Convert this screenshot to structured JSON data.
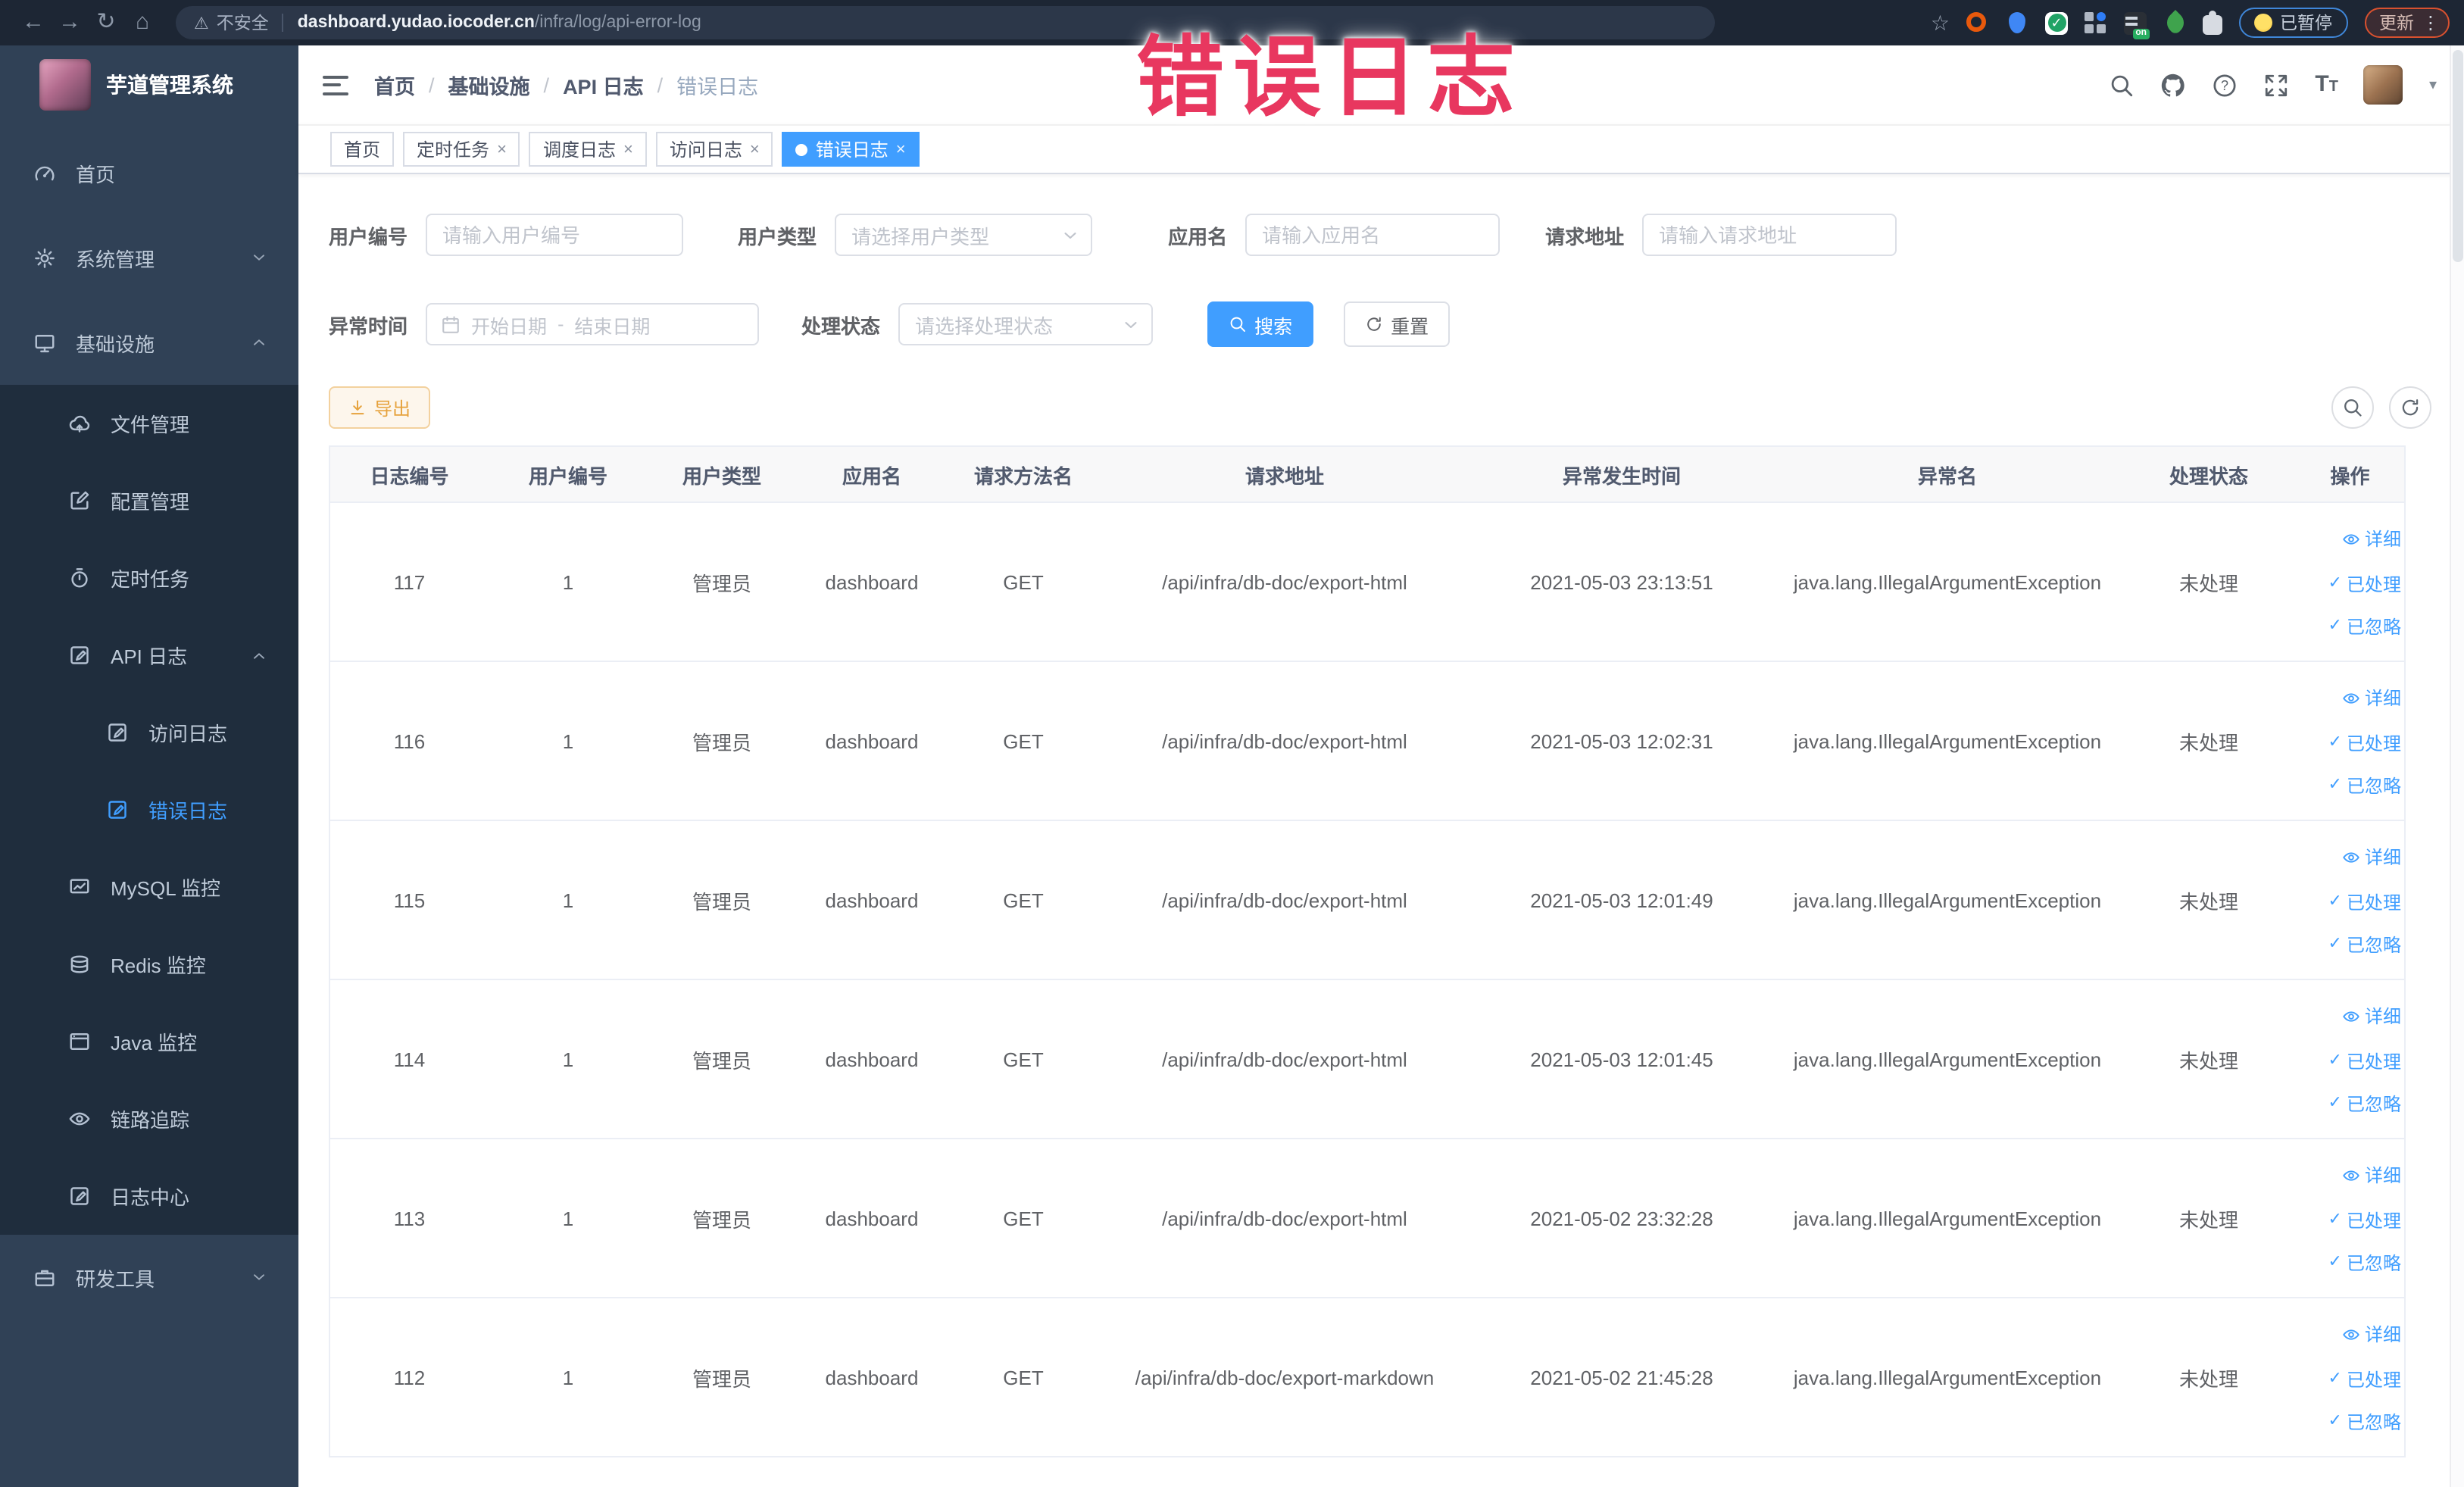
{
  "browser": {
    "security_warning": "不安全",
    "url_domain": "dashboard.yudao.iocoder.cn",
    "url_path": "/infra/log/api-error-log",
    "paused_badge": "已暂停",
    "update_button": "更新"
  },
  "overlay_title": "错误日志",
  "sidebar": {
    "logo_title": "芋道管理系统",
    "menu": [
      {
        "key": "home",
        "label": "首页",
        "icon": "gauge",
        "level": 1
      },
      {
        "key": "system-mgmt",
        "label": "系统管理",
        "icon": "gear",
        "level": 1,
        "chevron": "down"
      },
      {
        "key": "infrastructure",
        "label": "基础设施",
        "icon": "monitor",
        "level": 1,
        "chevron": "up"
      },
      {
        "key": "file-mgmt",
        "label": "文件管理",
        "icon": "cloud",
        "level": 2,
        "group": true
      },
      {
        "key": "config-mgmt",
        "label": "配置管理",
        "icon": "editpen",
        "level": 2,
        "group": true
      },
      {
        "key": "scheduled-tasks",
        "label": "定时任务",
        "icon": "timer",
        "level": 2,
        "group": true
      },
      {
        "key": "api-log",
        "label": "API 日志",
        "icon": "logdoc",
        "level": 2,
        "group": true,
        "chevron": "up"
      },
      {
        "key": "access-log",
        "label": "访问日志",
        "icon": "logdoc",
        "level": 3,
        "group": true
      },
      {
        "key": "error-log",
        "label": "错误日志",
        "icon": "logdoc",
        "level": 3,
        "group": true,
        "active": true
      },
      {
        "key": "mysql-monitor",
        "label": "MySQL 监控",
        "icon": "mysql",
        "level": 2,
        "group": true
      },
      {
        "key": "redis-monitor",
        "label": "Redis 监控",
        "icon": "redis",
        "level": 2,
        "group": true
      },
      {
        "key": "java-monitor",
        "label": "Java 监控",
        "icon": "java",
        "level": 2,
        "group": true
      },
      {
        "key": "trace",
        "label": "链路追踪",
        "icon": "eye",
        "level": 2,
        "group": true
      },
      {
        "key": "log-center",
        "label": "日志中心",
        "icon": "logdoc",
        "level": 2,
        "group": true
      },
      {
        "key": "dev-tools",
        "label": "研发工具",
        "icon": "briefcase",
        "level": 1,
        "chevron": "down"
      }
    ]
  },
  "header": {
    "breadcrumb": [
      "首页",
      "基础设施",
      "API 日志",
      "错误日志"
    ]
  },
  "tabs": [
    {
      "label": "首页",
      "closable": false,
      "active": false
    },
    {
      "label": "定时任务",
      "closable": true,
      "active": false
    },
    {
      "label": "调度日志",
      "closable": true,
      "active": false
    },
    {
      "label": "访问日志",
      "closable": true,
      "active": false
    },
    {
      "label": "错误日志",
      "closable": true,
      "active": true
    }
  ],
  "filters": {
    "user_id": {
      "label": "用户编号",
      "placeholder": "请输入用户编号"
    },
    "user_type": {
      "label": "用户类型",
      "placeholder": "请选择用户类型"
    },
    "app_name": {
      "label": "应用名",
      "placeholder": "请输入应用名"
    },
    "request_url": {
      "label": "请求地址",
      "placeholder": "请输入请求地址"
    },
    "exception_time": {
      "label": "异常时间",
      "start_placeholder": "开始日期",
      "separator": "-",
      "end_placeholder": "结束日期"
    },
    "process_status": {
      "label": "处理状态",
      "placeholder": "请选择处理状态"
    },
    "search_button": "搜索",
    "reset_button": "重置"
  },
  "toolbar": {
    "export_button": "导出"
  },
  "table": {
    "columns": [
      "日志编号",
      "用户编号",
      "用户类型",
      "应用名",
      "请求方法名",
      "请求地址",
      "异常发生时间",
      "异常名",
      "处理状态",
      "操作"
    ],
    "action_labels": [
      "详细",
      "已处理",
      "已忽略"
    ],
    "rows": [
      {
        "id": "117",
        "user_id": "1",
        "user_type": "管理员",
        "app_name": "dashboard",
        "method": "GET",
        "url": "/api/infra/db-doc/export-html",
        "time": "2021-05-03 23:13:51",
        "exception": "java.lang.IllegalArgumentException",
        "status": "未处理"
      },
      {
        "id": "116",
        "user_id": "1",
        "user_type": "管理员",
        "app_name": "dashboard",
        "method": "GET",
        "url": "/api/infra/db-doc/export-html",
        "time": "2021-05-03 12:02:31",
        "exception": "java.lang.IllegalArgumentException",
        "status": "未处理"
      },
      {
        "id": "115",
        "user_id": "1",
        "user_type": "管理员",
        "app_name": "dashboard",
        "method": "GET",
        "url": "/api/infra/db-doc/export-html",
        "time": "2021-05-03 12:01:49",
        "exception": "java.lang.IllegalArgumentException",
        "status": "未处理"
      },
      {
        "id": "114",
        "user_id": "1",
        "user_type": "管理员",
        "app_name": "dashboard",
        "method": "GET",
        "url": "/api/infra/db-doc/export-html",
        "time": "2021-05-03 12:01:45",
        "exception": "java.lang.IllegalArgumentException",
        "status": "未处理"
      },
      {
        "id": "113",
        "user_id": "1",
        "user_type": "管理员",
        "app_name": "dashboard",
        "method": "GET",
        "url": "/api/infra/db-doc/export-html",
        "time": "2021-05-02 23:32:28",
        "exception": "java.lang.IllegalArgumentException",
        "status": "未处理"
      },
      {
        "id": "112",
        "user_id": "1",
        "user_type": "管理员",
        "app_name": "dashboard",
        "method": "GET",
        "url": "/api/infra/db-doc/export-markdown",
        "time": "2021-05-02 21:45:28",
        "exception": "java.lang.IllegalArgumentException",
        "status": "未处理"
      }
    ]
  },
  "colors": {
    "accent": "#409eff",
    "overlay": "#e8375f",
    "warning": "#e6a23c",
    "sidebar_bg": "#304156",
    "submenu_bg": "#1f2d3d"
  }
}
